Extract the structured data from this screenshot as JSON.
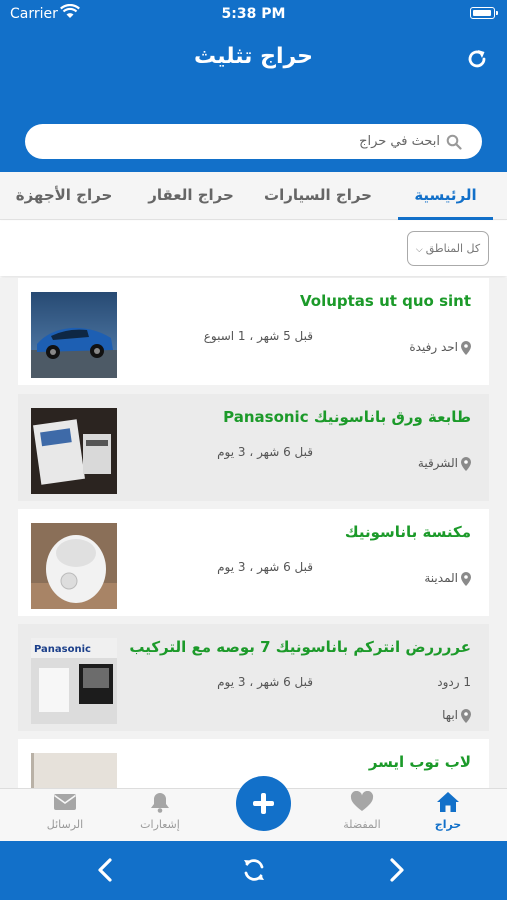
{
  "status_bar": {
    "carrier": "Carrier",
    "time": "5:38 PM"
  },
  "header": {
    "title": "حراج تثليث"
  },
  "search": {
    "placeholder": "ابحث في حراج"
  },
  "tabs": [
    {
      "label": "الرئيسية"
    },
    {
      "label": "حراج السيارات"
    },
    {
      "label": "حراج العقار"
    },
    {
      "label": "حراج الأجهزة"
    }
  ],
  "filter": {
    "label": "كل المناطق"
  },
  "listings": [
    {
      "title": "Voluptas ut quo sint",
      "time": "قبل 5 شهر ، 1 اسبوع",
      "location": "احد رفيدة"
    },
    {
      "title": "طابعة ورق باناسونيك Panasonic",
      "time": "قبل 6 شهر ، 3 يوم",
      "location": "الشرقية"
    },
    {
      "title": "مكنسة باناسونيك",
      "time": "قبل 6 شهر ، 3 يوم",
      "location": "المدينة"
    },
    {
      "title": "عررررض انتركم باناسونيك 7 بوصه مع التركيب",
      "time": "قبل 6 شهر ، 3 يوم",
      "replies": "1 ردود",
      "location": "ابها"
    },
    {
      "title": "لاب توب ايسر"
    }
  ],
  "thumbnails": [
    {
      "brand_text": ""
    },
    {
      "brand_text": ""
    },
    {
      "brand_text": ""
    },
    {
      "brand_text": "Panasonic"
    },
    {
      "brand_text": ""
    }
  ],
  "tabbar": [
    {
      "label": "حراج",
      "icon": "home-icon"
    },
    {
      "label": "المفضلة",
      "icon": "heart-icon"
    },
    {
      "label": "إشعارات",
      "icon": "bell-icon"
    },
    {
      "label": "الرسائل",
      "icon": "envelope-icon"
    }
  ],
  "colors": {
    "primary": "#1270c9",
    "title_green": "#1c9a2a",
    "inactive": "#9a9a9a"
  }
}
